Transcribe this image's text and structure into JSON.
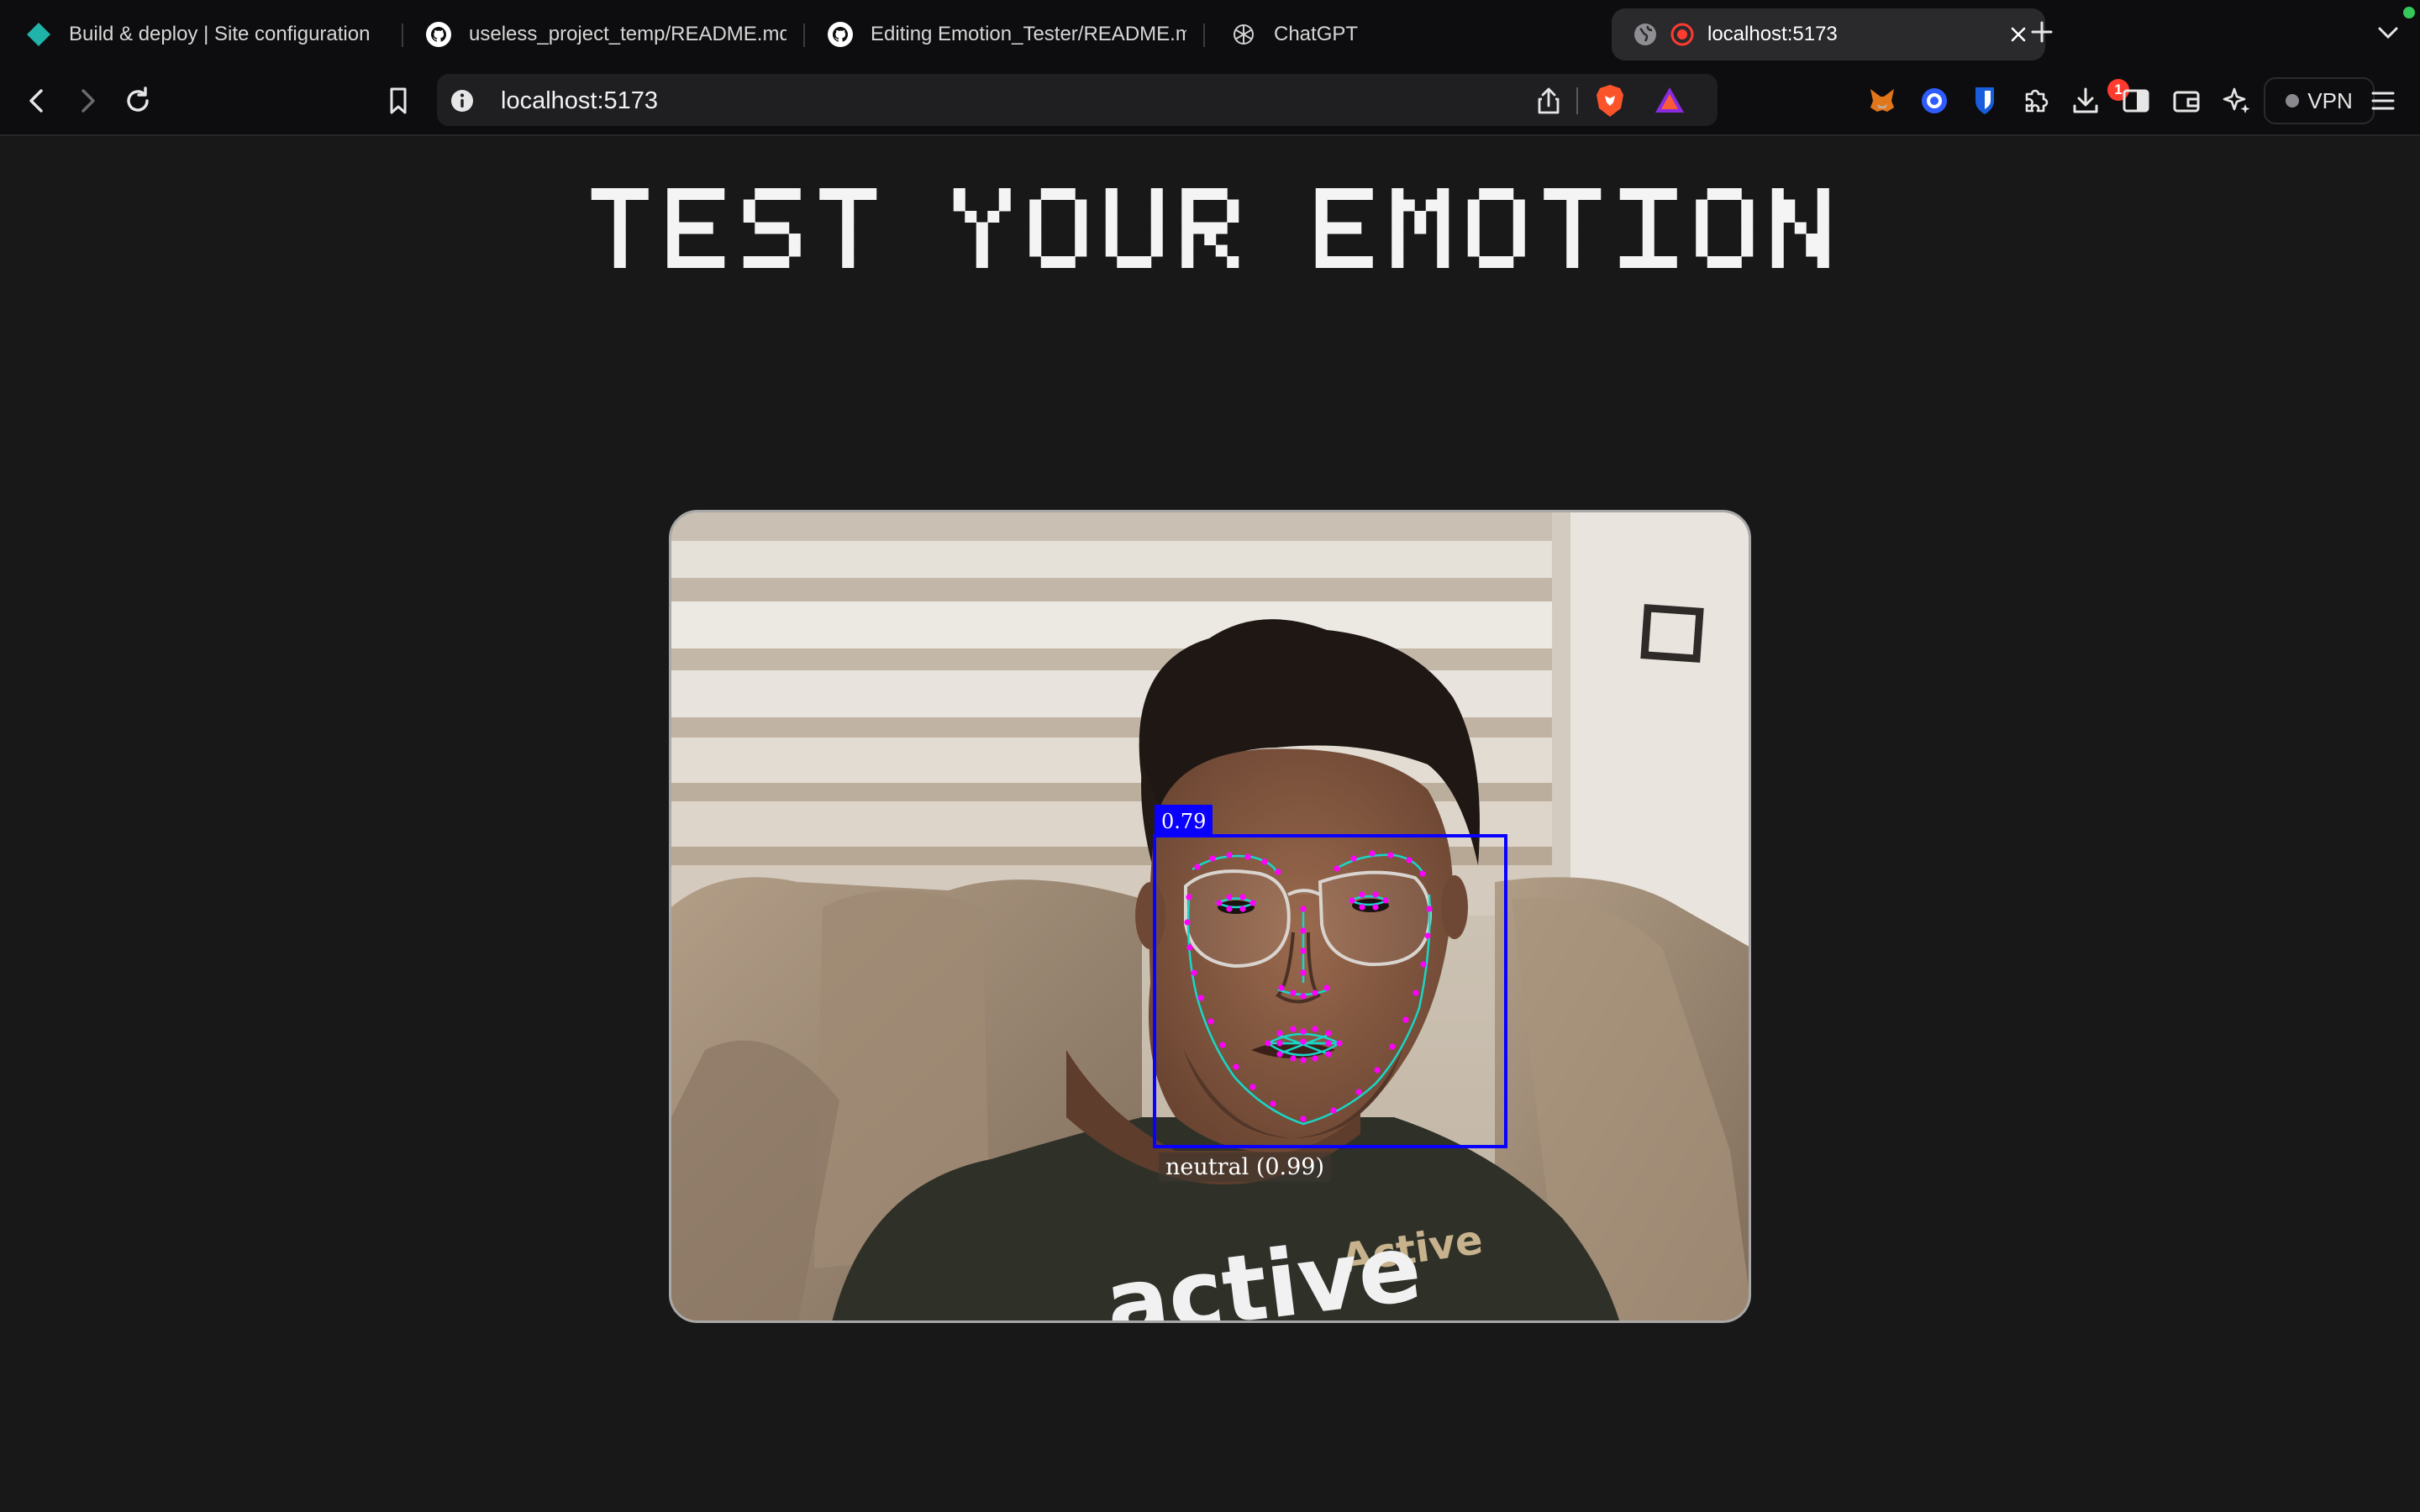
{
  "browser": {
    "tabs": [
      {
        "title": "Build & deploy | Site configuration",
        "icon": "netlify-diamond-icon",
        "active": false
      },
      {
        "title": "useless_project_temp/README.md",
        "icon": "github-icon",
        "active": false
      },
      {
        "title": "Editing Emotion_Tester/README.md",
        "icon": "github-icon",
        "active": false
      },
      {
        "title": "ChatGPT",
        "icon": "openai-icon",
        "active": false
      },
      {
        "title": "localhost:5173",
        "icon": "globe-icon",
        "active": true,
        "recording": true
      }
    ],
    "url": "localhost:5173",
    "notification_count": "1",
    "vpn_label": "VPN",
    "colors": {
      "accent_record": "#ff3b30",
      "status_green": "#34c759"
    }
  },
  "page": {
    "title": "TEST YOUR EMOTION"
  },
  "detection": {
    "score": "0.79",
    "emotion_label": "neutral (0.99)",
    "box_color": "#0a00ff",
    "landmark_color": "#ff00ff",
    "contour_color": "#19d6c8"
  }
}
